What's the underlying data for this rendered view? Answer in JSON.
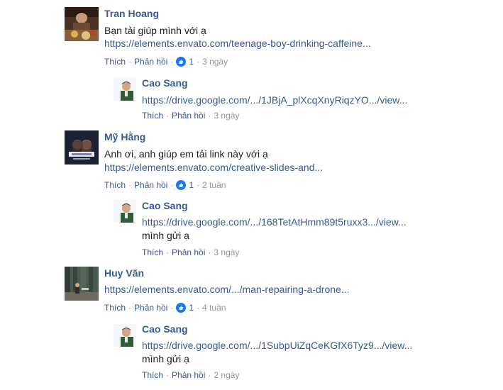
{
  "comments": [
    {
      "author": "Tran Hoang",
      "text": "Bạn tải giúp mình với ạ",
      "link": "https://elements.envato.com/teenage-boy-drinking-caffeine...",
      "like": "Thích",
      "reply": "Phản hồi",
      "reactions": "1",
      "time": "3 ngày",
      "reply_item": {
        "author": "Cao Sang",
        "link": "https://drive.google.com/.../1JBjA_plXcqXnyRiqzYO.../view...",
        "like": "Thích",
        "reply": "Phản hồi",
        "time": "3 ngày"
      }
    },
    {
      "author": "Mỹ Hằng",
      "text": "Anh ơi, anh giúp em tải link này với ạ",
      "link": "https://elements.envato.com/creative-slides-and...",
      "like": "Thích",
      "reply": "Phản hồi",
      "reactions": "1",
      "time": "2 tuần",
      "reply_item": {
        "author": "Cao Sang",
        "link": "https://drive.google.com/.../168TetAtHmm89t5ruxx3.../view...",
        "text": "mình gửi ạ",
        "like": "Thích",
        "reply": "Phản hồi",
        "time": "3 ngày"
      }
    },
    {
      "author": "Huy Văn",
      "link": "https://elements.envato.com/.../man-repairing-a-drone...",
      "like": "Thích",
      "reply": "Phản hồi",
      "reactions": "1",
      "time": "4 tuần",
      "reply_item": {
        "author": "Cao Sang",
        "link": "https://drive.google.com/.../1SubpUiZqCeKGfX6Tyz9.../view...",
        "text": "mình gửi ạ",
        "like": "Thích",
        "reply": "Phản hồi",
        "time": "2 ngày"
      }
    }
  ],
  "colors": {
    "link": "#385898",
    "text": "#1c1e21",
    "muted": "#90949c",
    "like_badge": "#1877f2"
  },
  "icons": {
    "like_reaction": "thumbs-up-icon"
  }
}
